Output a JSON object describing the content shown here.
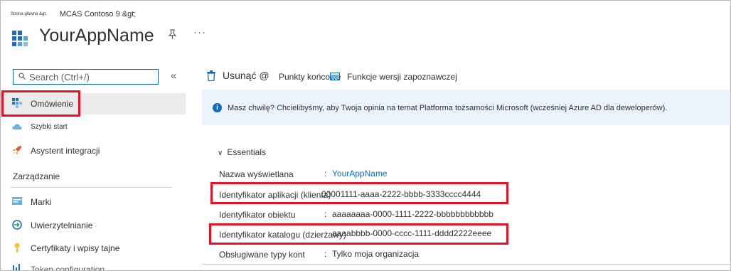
{
  "header": {
    "breadcrumb_home": "Strona główna &gt;",
    "breadcrumb_current": "MCAS Contoso 9 &gt;",
    "app_title": "YourAppName",
    "more_label": "···"
  },
  "search": {
    "placeholder": "Search (Ctrl+/)"
  },
  "sidebar": {
    "collapse_label": "«",
    "items": [
      {
        "label": "Omówienie",
        "icon": "overview-grid-icon"
      },
      {
        "label": "Szybki start",
        "icon": "quickstart-cloud-icon"
      },
      {
        "label": "Asystent integracji",
        "icon": "rocket-icon"
      }
    ],
    "section_label": "Zarządzanie",
    "manage_items": [
      {
        "label": "Marki",
        "icon": "branding-icon"
      },
      {
        "label": "Uwierzytelnianie",
        "icon": "authentication-icon"
      },
      {
        "label": "Certyfikaty i wpisy tajne",
        "icon": "key-icon"
      },
      {
        "label": "Token configuration",
        "icon": "token-bars-icon"
      }
    ]
  },
  "toolbar": {
    "delete_label": "Usunąć @",
    "endpoints_label": "Punkty końcowe",
    "preview_label": "Funkcje wersji zapoznawczej"
  },
  "info_bar": {
    "text": "Masz chwilę? Chcielibyśmy, aby Twoja opinia na temat Platforma tożsamości Microsoft (wcześniej Azure AD dla deweloperów)."
  },
  "essentials": {
    "title": "Essentials",
    "rows": [
      {
        "label": "Nazwa wyświetlana",
        "value": "YourAppName"
      },
      {
        "label": "Identyfikator aplikacji (klienta)",
        "value": "00001111-aaaa-2222-bbbb-3333cccc4444"
      },
      {
        "label": "Identyfikator obiektu",
        "value": "aaaaaaaa-0000-1111-2222-bbbbbbbbbbbb"
      },
      {
        "label": "Identyfikator katalogu (dzierżawy)",
        "value": "aaaabbbb-0000-cccc-1111-dddd2222eeee"
      },
      {
        "label": "Obsługiwane typy kont",
        "value": "Tylko moja organizacja"
      }
    ]
  },
  "colors": {
    "accent": "#0f6cbd",
    "highlight_box": "#e81123",
    "info_background": "#ebf3fc",
    "active_nav": "#edebe9"
  }
}
